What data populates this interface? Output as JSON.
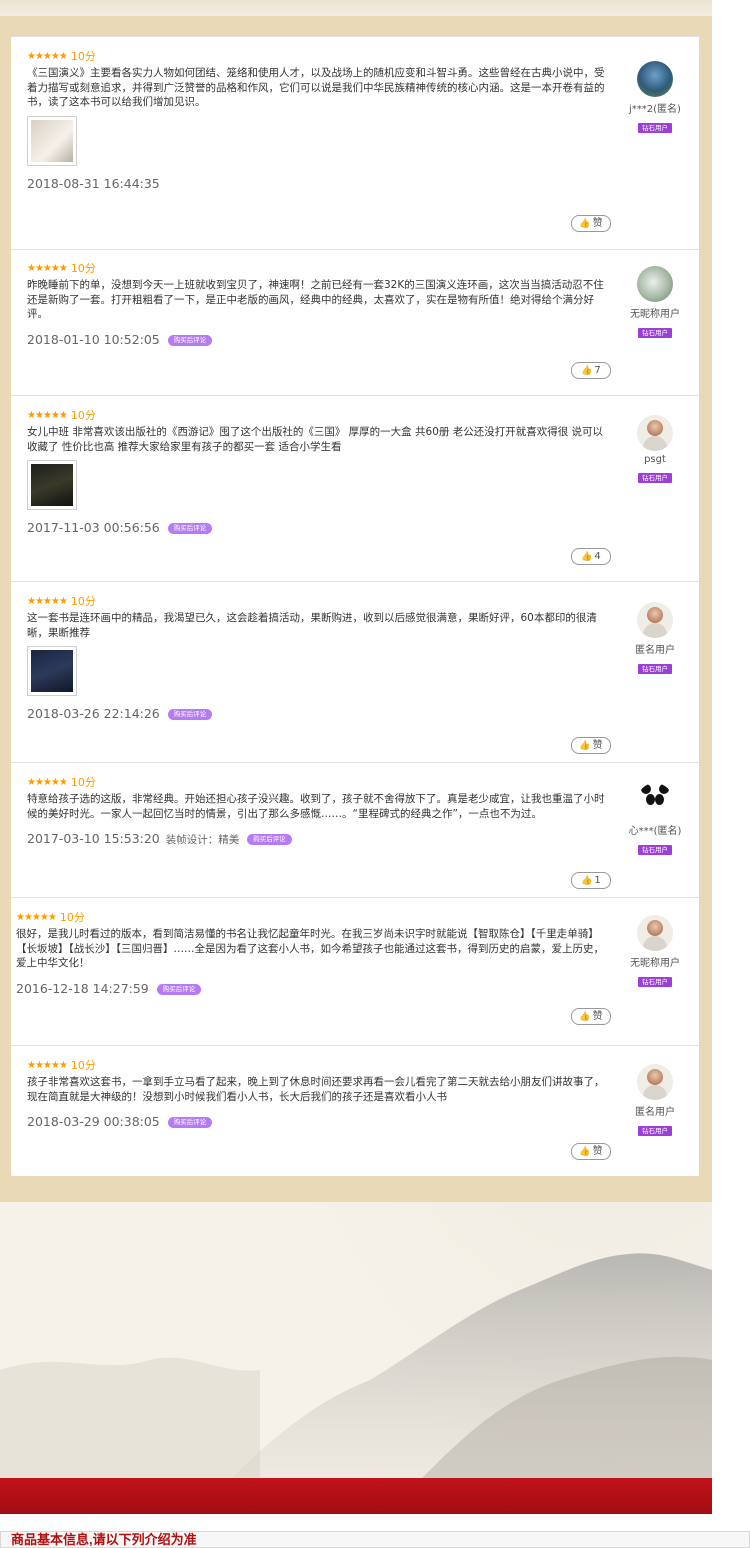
{
  "reviews": [
    {
      "stars": "★★★★★",
      "score": "10分",
      "text": "《三国演义》主要看各实力人物如何团结、笼络和使用人才，以及战场上的随机应变和斗智斗勇。这些曾经在古典小说中，受着力描写或刻意追求，并得到广泛赞誉的品格和作风，它们可以说是我们中华民族精神传统的核心内涵。这是一本开卷有益的书，读了这本书可以给我们增加见识。",
      "date": "2018-08-31 16:44:35",
      "like": "赞",
      "user": "j***2(匿名)",
      "level": "钻石用户"
    },
    {
      "stars": "★★★★★",
      "score": "10分",
      "text": "昨晚睡前下的单，没想到今天一上班就收到宝贝了，神速啊！之前已经有一套32K的三国演义连环画，这次当当搞活动忍不住还是新购了一套。打开粗粗看了一下，是正中老版的画风，经典中的经典，太喜欢了，实在是物有所值！绝对得给个满分好评。",
      "date": "2018-01-10 10:52:05",
      "tag": "购买后评论",
      "like": "7",
      "user": "无昵称用户",
      "level": "钻石用户"
    },
    {
      "stars": "★★★★★",
      "score": "10分",
      "text": "女儿中班 非常喜欢该出版社的《西游记》囤了这个出版社的《三国》 厚厚的一大盒 共60册 老公还没打开就喜欢得很 说可以收藏了 性价比也高 推荐大家给家里有孩子的都买一套 适合小学生看",
      "date": "2017-11-03 00:56:56",
      "tag": "购买后评论",
      "like": "4",
      "user": "psgt",
      "level": "钻石用户"
    },
    {
      "stars": "★★★★★",
      "score": "10分",
      "text": "这一套书是连环画中的精品，我渴望已久，这会趁着搞活动，果断购进，收到以后感觉很满意，果断好评，60本都印的很清晰，果断推荐",
      "date": "2018-03-26 22:14:26",
      "tag": "购买后评论",
      "like": "赞",
      "user": "匿名用户",
      "level": "钻石用户"
    },
    {
      "stars": "★★★★★",
      "score": "10分",
      "text": "特意给孩子选的这版，非常经典。开始还担心孩子没兴趣。收到了，孩子就不舍得放下了。真是老少咸宜，让我也重温了小时候的美好时光。一家人一起回忆当时的情景，引出了那么多感慨……。“里程碑式的经典之作”，一点也不为过。",
      "date": "2017-03-10 15:53:20",
      "extra": "装帧设计：精美",
      "tag": "购买后评论",
      "like": "1",
      "user": "心***(匿名)",
      "level": "钻石用户"
    },
    {
      "stars": "★★★★★",
      "score": "10分",
      "text": "很好，是我儿时看过的版本，看到简洁易懂的书名让我忆起童年时光。在我三岁尚未识字时就能说【智取陈仓】【千里走单骑】【长坂坡】【战长沙】【三国归晋】……全是因为看了这套小人书，如今希望孩子也能通过这套书，得到历史的启蒙，爱上历史，爱上中华文化！",
      "date": "2016-12-18 14:27:59",
      "tag": "购买后评论",
      "like": "赞",
      "user": "无昵称用户",
      "level": "钻石用户"
    },
    {
      "stars": "★★★★★",
      "score": "10分",
      "text": "孩子非常喜欢这套书，一拿到手立马看了起来，晚上到了休息时间还要求再看一会儿看完了第二天就去给小朋友们讲故事了，现在简直就是大神级的！没想到小时候我们看小人书，长大后我们的孩子还是喜欢看小人书",
      "date": "2018-03-29 00:38:05",
      "tag": "购买后评论",
      "like": "赞",
      "user": "匿名用户",
      "level": "钻石用户"
    }
  ],
  "footer": {
    "info_title": "商品基本信息,请以下列介绍为准"
  }
}
